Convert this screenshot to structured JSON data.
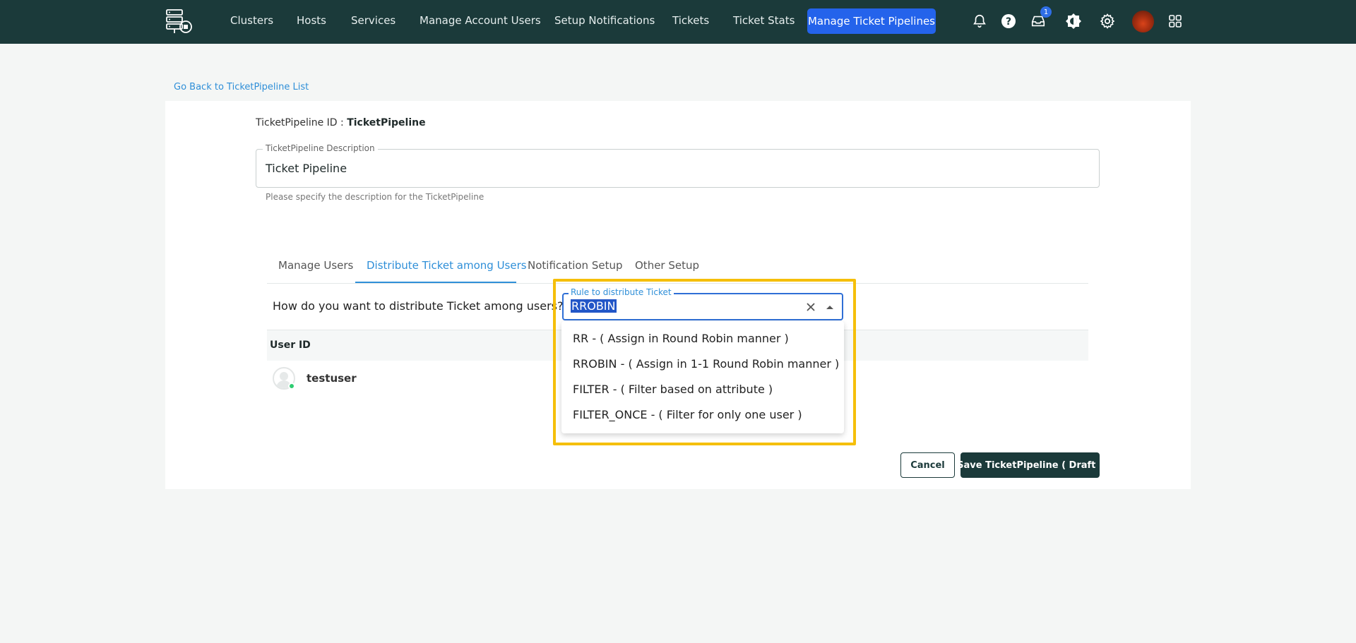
{
  "nav": {
    "items": [
      "Clusters",
      "Hosts",
      "Services",
      "Manage Account Users",
      "Setup Notifications",
      "Tickets",
      "Ticket Stats"
    ],
    "active": "Manage Ticket Pipelines",
    "notification_badge": "1"
  },
  "back_link": "Go Back to TicketPipeline List",
  "pipeline": {
    "id_label": "TicketPipeline ID : ",
    "id_value": "TicketPipeline",
    "description_label": "TicketPipeline Description",
    "description_value": "Ticket Pipeline",
    "description_help": "Please specify the description for the TicketPipeline"
  },
  "tabs": [
    "Manage Users",
    "Distribute Ticket among Users",
    "Notification Setup",
    "Other Setup"
  ],
  "distribution": {
    "question": "How do you want to distribute Ticket among users?",
    "select_label": "Rule to distribute Ticket",
    "select_value": "RROBIN",
    "options": [
      "RR - ( Assign in Round Robin manner )",
      "RROBIN - ( Assign in 1-1 Round Robin manner )",
      "FILTER - ( Filter based on attribute )",
      "FILTER_ONCE - ( Filter for only one user )"
    ]
  },
  "table": {
    "header": "User ID",
    "rows": [
      "testuser"
    ]
  },
  "buttons": {
    "cancel": "Cancel",
    "save": "Save TicketPipeline ( Draft )"
  },
  "colors": {
    "topbar": "#1b3a3a",
    "accent": "#2463eb",
    "link": "#2f8fd8",
    "highlight": "#f5bf0a"
  },
  "icons": [
    "logo-icon",
    "bell-icon",
    "help-icon",
    "inbox-icon",
    "theme-icon",
    "gear-icon",
    "avatar",
    "apps-grid-icon",
    "clear-icon",
    "caret-up-icon",
    "user-avatar-icon"
  ]
}
